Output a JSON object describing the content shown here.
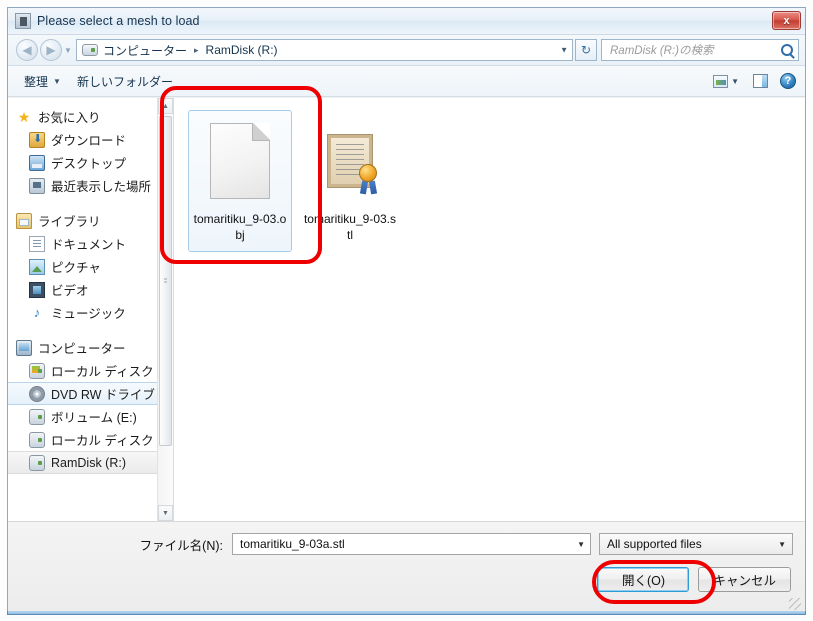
{
  "window": {
    "title": "Please select a mesh to load",
    "app_icon": "app-window-icon",
    "close_label": "x"
  },
  "address": {
    "back_icon": "back-arrow-icon",
    "forward_icon": "forward-arrow-icon",
    "history_icon": "chevron-down-icon",
    "drive_icon": "drive-icon",
    "breadcrumbs": [
      "コンピューター",
      "RamDisk (R:)"
    ],
    "separator": "▸",
    "dropdown_icon": "chevron-down-icon",
    "refresh_icon": "refresh-icon",
    "refresh_glyph": "↻"
  },
  "search": {
    "placeholder": "RamDisk (R:)の検索",
    "icon": "search-icon"
  },
  "toolbar": {
    "organize_label": "整理",
    "organize_caret": "▼",
    "new_folder_label": "新しいフォルダー",
    "view_icon": "view-mode-icon",
    "view_caret": "▼",
    "preview_pane_icon": "preview-pane-icon",
    "help_icon": "help-icon",
    "help_glyph": "?"
  },
  "sidebar": {
    "groups": [
      {
        "header": {
          "label": "お気に入り",
          "icon": "star-icon",
          "icon_class": "ic-star",
          "glyph": "★"
        },
        "items": [
          {
            "label": "ダウンロード",
            "icon": "downloads-icon",
            "icon_class": "ic-dl"
          },
          {
            "label": "デスクトップ",
            "icon": "desktop-icon",
            "icon_class": "ic-desktop"
          },
          {
            "label": "最近表示した場所",
            "icon": "recent-places-icon",
            "icon_class": "ic-recent"
          }
        ]
      },
      {
        "header": {
          "label": "ライブラリ",
          "icon": "library-icon",
          "icon_class": "ic-lib",
          "glyph": ""
        },
        "items": [
          {
            "label": "ドキュメント",
            "icon": "documents-icon",
            "icon_class": "ic-doc"
          },
          {
            "label": "ピクチャ",
            "icon": "pictures-icon",
            "icon_class": "ic-pic"
          },
          {
            "label": "ビデオ",
            "icon": "videos-icon",
            "icon_class": "ic-vid"
          },
          {
            "label": "ミュージック",
            "icon": "music-icon",
            "icon_class": "ic-music",
            "glyph": "♪"
          }
        ]
      },
      {
        "header": {
          "label": "コンピューター",
          "icon": "computer-icon",
          "icon_class": "ic-pc",
          "glyph": ""
        },
        "items": [
          {
            "label": "ローカル ディスク",
            "icon": "local-disk-icon",
            "icon_class": "ic-hdd ic-hdd-win"
          },
          {
            "label": "DVD RW ドライブ",
            "icon": "dvd-drive-icon",
            "icon_class": "ic-dvd",
            "state": "highlight"
          },
          {
            "label": "ボリューム (E:)",
            "icon": "volume-drive-icon",
            "icon_class": "ic-hdd"
          },
          {
            "label": "ローカル ディスク",
            "icon": "local-disk-icon",
            "icon_class": "ic-hdd"
          },
          {
            "label": "RamDisk (R:)",
            "icon": "ramdisk-drive-icon",
            "icon_class": "ic-hdd",
            "state": "selected"
          }
        ]
      }
    ],
    "scroll_up": "▲",
    "scroll_down": "▼"
  },
  "files": [
    {
      "name": "tomaritiku_9-03.obj",
      "icon": "generic-file-icon",
      "selected": true
    },
    {
      "name": "tomaritiku_9-03.stl",
      "icon": "certificate-file-icon",
      "selected": false
    }
  ],
  "footer": {
    "filename_label": "ファイル名(N):",
    "filename_value": "tomaritiku_9-03a.stl",
    "filename_caret": "▼",
    "filter_value": "All supported files",
    "filter_caret": "▼",
    "open_button": "開く(O)",
    "cancel_button": "キャンセル",
    "resize_grip": "resize-grip-icon"
  },
  "annotations": [
    {
      "name": "file-item-highlight",
      "shape": "rounded-rect",
      "color": "#ee0000"
    },
    {
      "name": "open-button-highlight",
      "shape": "rounded-rect",
      "color": "#ee0000"
    }
  ],
  "colors": {
    "annotation_red": "#ee0000",
    "selection_blue": "#a8cbe8",
    "default_button_border": "#2f9ad4"
  }
}
